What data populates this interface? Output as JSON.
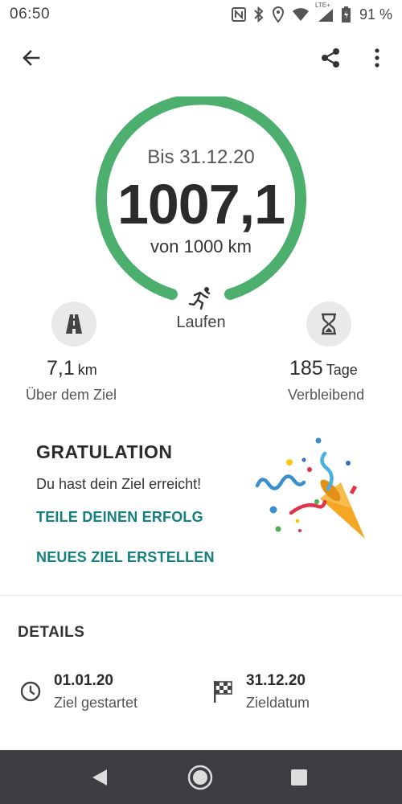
{
  "status_bar": {
    "time": "06:50",
    "network": "LTE+",
    "battery": "91 %"
  },
  "app_bar": {
    "back_icon": "arrow-back-icon",
    "share_icon": "share-icon",
    "more_icon": "more-vert-icon"
  },
  "goal": {
    "until": "Bis 31.12.20",
    "value": "1007,1",
    "target": "von 1000 km",
    "progress_percent": 100,
    "ring_color": "#4caf6e",
    "activity_icon": "running-icon",
    "activity": "Laufen"
  },
  "stats": {
    "left": {
      "icon": "road-icon",
      "value": "7,1",
      "unit": "km",
      "label": "Über dem Ziel"
    },
    "right": {
      "icon": "hourglass-icon",
      "value": "185",
      "unit": "Tage",
      "label": "Verbleibend"
    }
  },
  "congrats": {
    "title": "GRATULATION",
    "text": "Du hast dein Ziel erreicht!",
    "share_link": "TEILE DEINEN ERFOLG",
    "new_goal_link": "NEUES ZIEL ERSTELLEN",
    "link_color": "#14807f",
    "illustration": "party-popper-icon"
  },
  "details": {
    "title": "DETAILS",
    "start": {
      "icon": "clock-icon",
      "date": "01.01.20",
      "label": "Ziel gestartet"
    },
    "end": {
      "icon": "checkered-flag-icon",
      "date": "31.12.20",
      "label": "Zieldatum"
    }
  },
  "nav_bar": {
    "back_icon": "nav-back-icon",
    "home_icon": "nav-home-icon",
    "recent_icon": "nav-recent-icon"
  }
}
